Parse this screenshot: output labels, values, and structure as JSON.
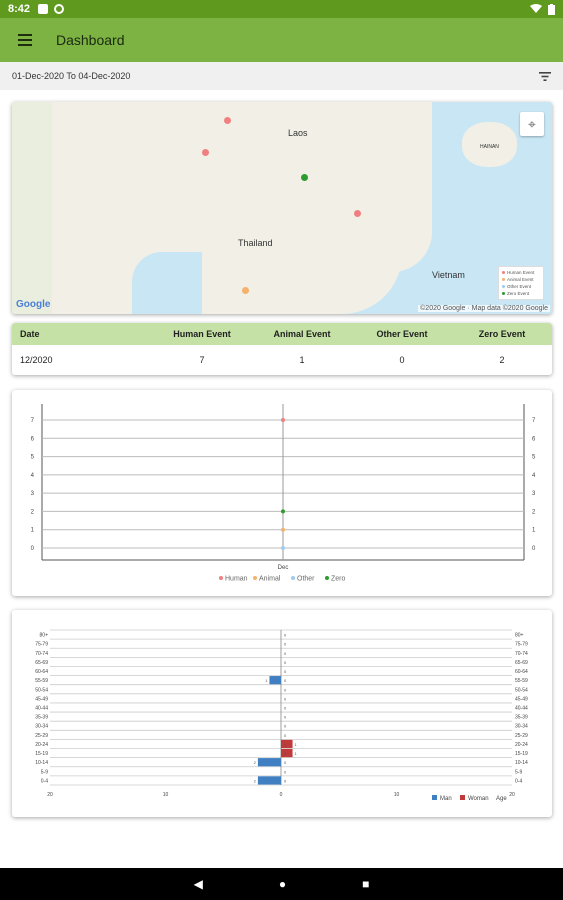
{
  "status_bar": {
    "time": "8:42"
  },
  "app_bar": {
    "title": "Dashboard"
  },
  "date_filter": {
    "range": "01-Dec-2020 To 04-Dec-2020"
  },
  "map": {
    "labels": [
      "Laos",
      "Thailand",
      "Vietnam",
      "HAINAN"
    ],
    "legend": [
      "Human Event",
      "Animal Event",
      "Other Event",
      "Zero Event"
    ],
    "attribution": "©2020 Google · Map data ©2020 Google",
    "logo": "Google",
    "colors": {
      "human": "#f08080",
      "animal": "#f5b26b",
      "other": "#9ecbf0",
      "zero": "#2e9b2e"
    }
  },
  "summary_table": {
    "headers": [
      "Date",
      "Human Event",
      "Animal Event",
      "Other Event",
      "Zero Event"
    ],
    "rows": [
      [
        "12/2020",
        "7",
        "1",
        "0",
        "2"
      ]
    ]
  },
  "chart_data": [
    {
      "type": "scatter",
      "categories": [
        "Dec"
      ],
      "ylim": [
        0,
        7
      ],
      "yticks": [
        "0",
        "1",
        "2",
        "3",
        "4",
        "5",
        "6",
        "7"
      ],
      "series": [
        {
          "name": "Human",
          "values": [
            7
          ],
          "color": "#f08080"
        },
        {
          "name": "Animal",
          "values": [
            1
          ],
          "color": "#f5b26b"
        },
        {
          "name": "Other",
          "values": [
            0
          ],
          "color": "#9ecbf0"
        },
        {
          "name": "Zero",
          "values": [
            2
          ],
          "color": "#2e9b2e"
        }
      ],
      "grid": true,
      "legend": "bottom"
    },
    {
      "type": "bar",
      "orientation": "horizontal-population-pyramid",
      "categories": [
        "0-4",
        "5-9",
        "10-14",
        "15-19",
        "20-24",
        "25-29",
        "30-34",
        "35-39",
        "40-44",
        "45-49",
        "50-54",
        "55-59",
        "60-64",
        "65-69",
        "70-74",
        "75-79",
        "80+"
      ],
      "xticks": [
        "20",
        "10",
        "0",
        "10",
        "20"
      ],
      "xlim": [
        -20,
        20
      ],
      "series": [
        {
          "name": "Man",
          "values": [
            -2,
            0,
            -2,
            0,
            0,
            0,
            0,
            0,
            0,
            0,
            0,
            -1,
            0,
            0,
            0,
            0,
            0
          ],
          "color": "#3f7fc2"
        },
        {
          "name": "Woman",
          "values": [
            0,
            0,
            0,
            1,
            1,
            0,
            0,
            0,
            0,
            0,
            0,
            0,
            0,
            0,
            0,
            0,
            0
          ],
          "color": "#c0393b"
        }
      ],
      "legend_extra": "Age",
      "legend": "bottom-right"
    }
  ]
}
